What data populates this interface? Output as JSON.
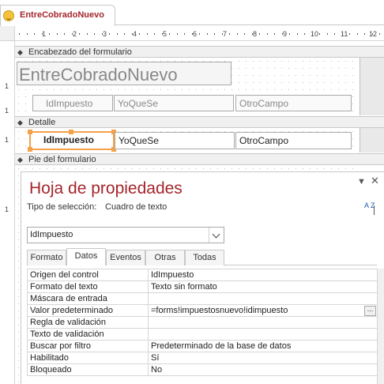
{
  "tab": {
    "title": "EntreCobradoNuevo",
    "icon": "smiley-icon"
  },
  "ruler": {
    "horizontal": [
      "1",
      "2",
      "3",
      "4",
      "5",
      "6",
      "7",
      "8",
      "9",
      "10",
      "11",
      "12"
    ],
    "vertical": [
      "1",
      "1",
      "1",
      "1"
    ]
  },
  "sections": {
    "header": "Encabezado del formulario",
    "detail": "Detalle",
    "footer": "Pie del formulario"
  },
  "form_header": {
    "title": "EntreCobradoNuevo",
    "labels": [
      "IdImpuesto",
      "YoQueSe",
      "OtroCampo"
    ]
  },
  "detail": {
    "controls": [
      "IdImpuesto",
      "YoQueSe",
      "OtroCampo"
    ],
    "selected": "IdImpuesto"
  },
  "property_sheet": {
    "title": "Hoja de propiedades",
    "selection_label": "Tipo de selección:",
    "selection_value": "Cuadro de texto",
    "object": "IdImpuesto",
    "tabs": [
      "Formato",
      "Datos",
      "Eventos",
      "Otras",
      "Todas"
    ],
    "active_tab": "Datos",
    "sort_label": "A Z",
    "rows": [
      {
        "name": "Origen del control",
        "value": "IdImpuesto"
      },
      {
        "name": "Formato del texto",
        "value": "Texto sin formato"
      },
      {
        "name": "Máscara de entrada",
        "value": ""
      },
      {
        "name": "Valor predeterminado",
        "value": "=forms!impuestosnuevo!idimpuesto"
      },
      {
        "name": "Regla de validación",
        "value": ""
      },
      {
        "name": "Texto de validación",
        "value": ""
      },
      {
        "name": "Buscar por filtro",
        "value": "Predeterminado de la base de datos"
      },
      {
        "name": "Habilitado",
        "value": "Sí"
      },
      {
        "name": "Bloqueado",
        "value": "No"
      }
    ],
    "builder_button": "..."
  },
  "colors": {
    "accent": "#a4262c",
    "selection": "#f3a24a"
  }
}
